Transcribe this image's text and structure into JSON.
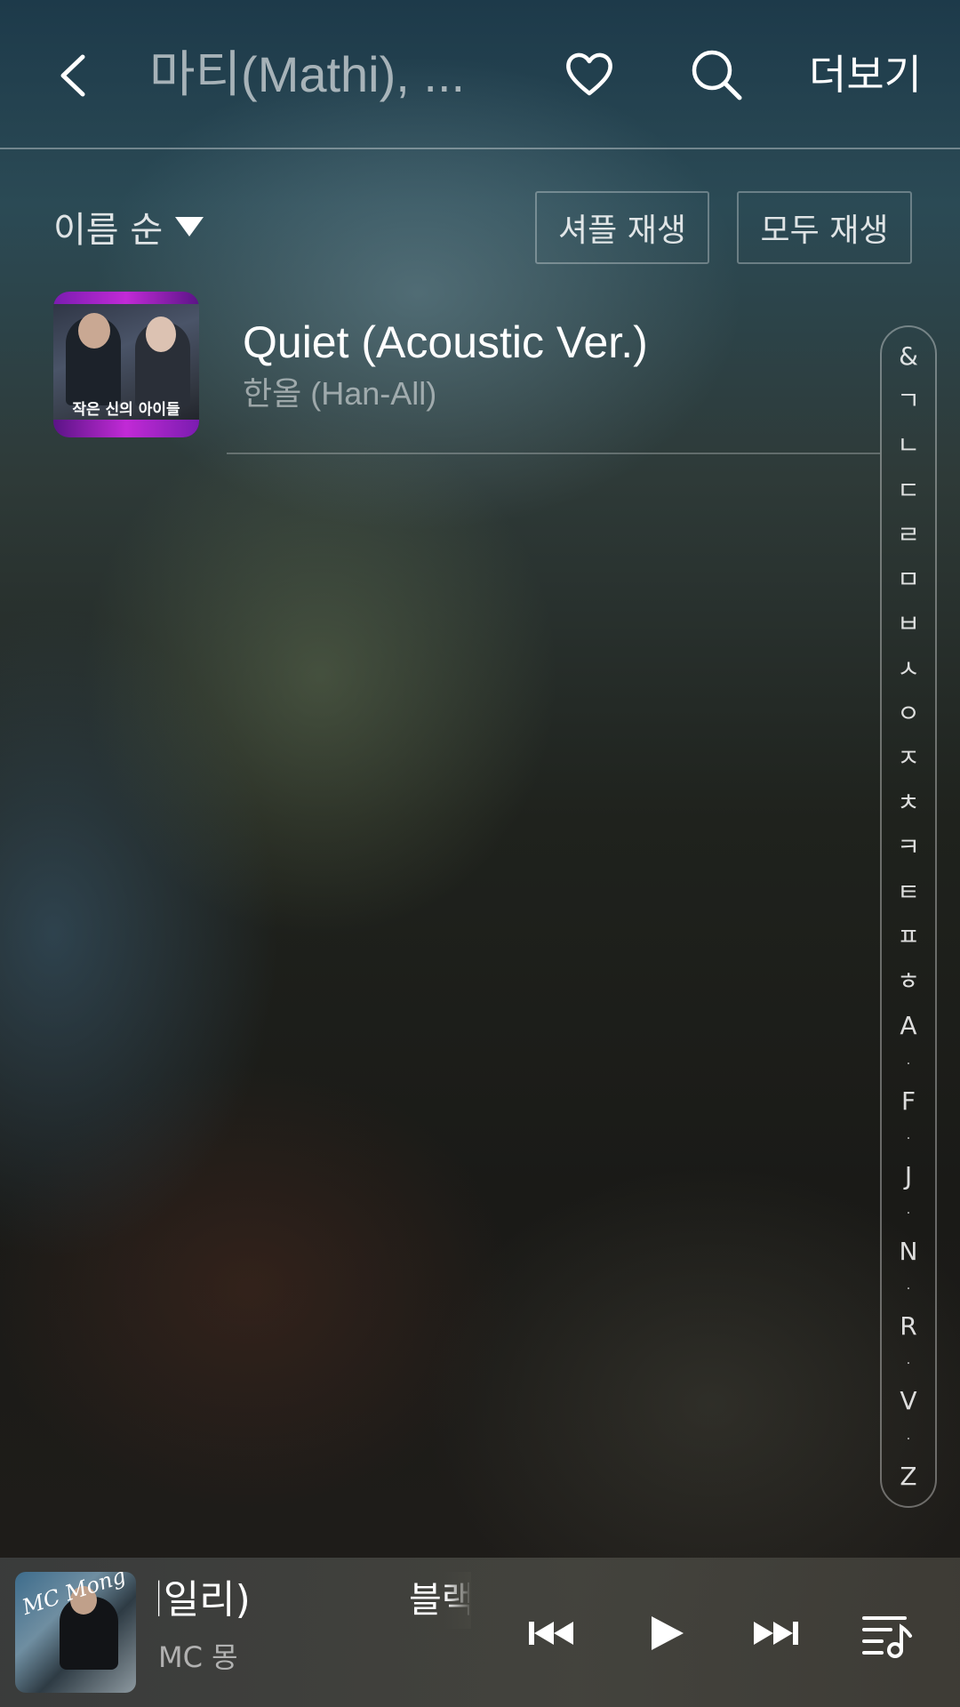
{
  "header": {
    "title": "마티(Mathi), ...",
    "more_label": "더보기"
  },
  "toolbar": {
    "sort_label": "이름 순",
    "shuffle_label": "셔플 재생",
    "play_all_label": "모두 재생"
  },
  "tracks": [
    {
      "title": "Quiet (Acoustic Ver.)",
      "artist": "한올 (Han-All)",
      "art_text": "작은 신의 아이들"
    }
  ],
  "index_bar": [
    "&",
    "ㄱ",
    "ㄴ",
    "ㄷ",
    "ㄹ",
    "ㅁ",
    "ㅂ",
    "ㅅ",
    "ㅇ",
    "ㅈ",
    "ㅊ",
    "ㅋ",
    "ㅌ",
    "ㅍ",
    "ㅎ",
    "A",
    "·",
    "F",
    "·",
    "J",
    "·",
    "N",
    "·",
    "R",
    "·",
    "V",
    "·",
    "Z"
  ],
  "mini_player": {
    "title": "t. 에일리)",
    "next_title": "블랙",
    "artist": "MC 몽",
    "art_text": "MC Mong"
  },
  "icons": {
    "back": "chevron-left-icon",
    "heart": "heart-icon",
    "search": "search-icon",
    "prev": "skip-previous-icon",
    "play": "play-icon",
    "next": "skip-next-icon",
    "queue": "playlist-music-icon"
  }
}
